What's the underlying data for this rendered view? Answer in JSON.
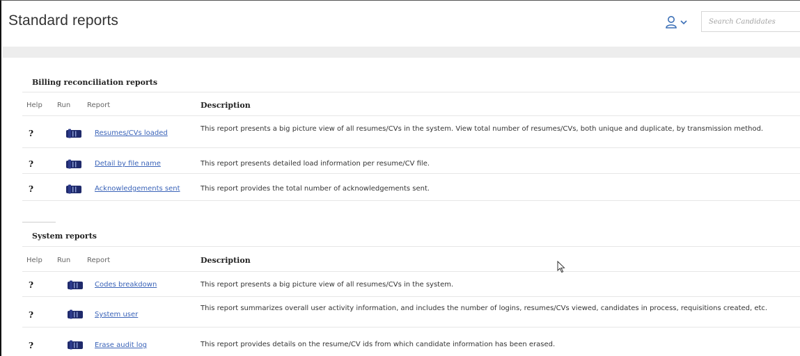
{
  "header": {
    "title": "Standard reports",
    "user_icon": "user-icon",
    "search_placeholder": "Search Candidates"
  },
  "billing": {
    "title": "Billing reconciliation reports",
    "columns": {
      "help": "Help",
      "run": "Run",
      "report": "Report",
      "description": "Description"
    },
    "rows": [
      {
        "help": "?",
        "report": "Resumes/CVs loaded",
        "description": "This report presents a big picture view of all resumes/CVs in the system. View total number of resumes/CVs, both unique and duplicate, by transmission method."
      },
      {
        "help": "?",
        "report": "Detail by file name",
        "description": "This report presents detailed load information per resume/CV file."
      },
      {
        "help": "?",
        "report": "Acknowledgements sent",
        "description": "This report provides the total number of acknowledgements sent."
      }
    ]
  },
  "system": {
    "title": "System reports",
    "columns": {
      "help": "Help",
      "run": "Run",
      "report": "Report",
      "description": "Description"
    },
    "rows": [
      {
        "help": "?",
        "report": "Codes breakdown",
        "description": "This report presents a big picture view of all resumes/CVs in the system."
      },
      {
        "help": "?",
        "report": "System user",
        "description": "This report summarizes overall user activity information, and includes the number of logins, resumes/CVs viewed, candidates in process, requisitions created, etc."
      },
      {
        "help": "?",
        "report": "Erase audit log",
        "description": "This report provides details on the resume/CV ids from which candidate information has been erased."
      }
    ]
  },
  "colors": {
    "link": "#3a63b8",
    "run_icon": "#1f2a6b",
    "band": "#ededed"
  }
}
